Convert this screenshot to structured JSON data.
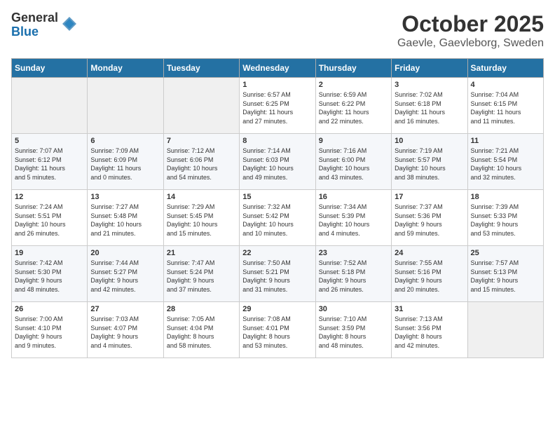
{
  "logo": {
    "general": "General",
    "blue": "Blue"
  },
  "title": "October 2025",
  "subtitle": "Gaevle, Gaevleborg, Sweden",
  "days_of_week": [
    "Sunday",
    "Monday",
    "Tuesday",
    "Wednesday",
    "Thursday",
    "Friday",
    "Saturday"
  ],
  "weeks": [
    [
      {
        "day": "",
        "info": ""
      },
      {
        "day": "",
        "info": ""
      },
      {
        "day": "",
        "info": ""
      },
      {
        "day": "1",
        "info": "Sunrise: 6:57 AM\nSunset: 6:25 PM\nDaylight: 11 hours\nand 27 minutes."
      },
      {
        "day": "2",
        "info": "Sunrise: 6:59 AM\nSunset: 6:22 PM\nDaylight: 11 hours\nand 22 minutes."
      },
      {
        "day": "3",
        "info": "Sunrise: 7:02 AM\nSunset: 6:18 PM\nDaylight: 11 hours\nand 16 minutes."
      },
      {
        "day": "4",
        "info": "Sunrise: 7:04 AM\nSunset: 6:15 PM\nDaylight: 11 hours\nand 11 minutes."
      }
    ],
    [
      {
        "day": "5",
        "info": "Sunrise: 7:07 AM\nSunset: 6:12 PM\nDaylight: 11 hours\nand 5 minutes."
      },
      {
        "day": "6",
        "info": "Sunrise: 7:09 AM\nSunset: 6:09 PM\nDaylight: 11 hours\nand 0 minutes."
      },
      {
        "day": "7",
        "info": "Sunrise: 7:12 AM\nSunset: 6:06 PM\nDaylight: 10 hours\nand 54 minutes."
      },
      {
        "day": "8",
        "info": "Sunrise: 7:14 AM\nSunset: 6:03 PM\nDaylight: 10 hours\nand 49 minutes."
      },
      {
        "day": "9",
        "info": "Sunrise: 7:16 AM\nSunset: 6:00 PM\nDaylight: 10 hours\nand 43 minutes."
      },
      {
        "day": "10",
        "info": "Sunrise: 7:19 AM\nSunset: 5:57 PM\nDaylight: 10 hours\nand 38 minutes."
      },
      {
        "day": "11",
        "info": "Sunrise: 7:21 AM\nSunset: 5:54 PM\nDaylight: 10 hours\nand 32 minutes."
      }
    ],
    [
      {
        "day": "12",
        "info": "Sunrise: 7:24 AM\nSunset: 5:51 PM\nDaylight: 10 hours\nand 26 minutes."
      },
      {
        "day": "13",
        "info": "Sunrise: 7:27 AM\nSunset: 5:48 PM\nDaylight: 10 hours\nand 21 minutes."
      },
      {
        "day": "14",
        "info": "Sunrise: 7:29 AM\nSunset: 5:45 PM\nDaylight: 10 hours\nand 15 minutes."
      },
      {
        "day": "15",
        "info": "Sunrise: 7:32 AM\nSunset: 5:42 PM\nDaylight: 10 hours\nand 10 minutes."
      },
      {
        "day": "16",
        "info": "Sunrise: 7:34 AM\nSunset: 5:39 PM\nDaylight: 10 hours\nand 4 minutes."
      },
      {
        "day": "17",
        "info": "Sunrise: 7:37 AM\nSunset: 5:36 PM\nDaylight: 9 hours\nand 59 minutes."
      },
      {
        "day": "18",
        "info": "Sunrise: 7:39 AM\nSunset: 5:33 PM\nDaylight: 9 hours\nand 53 minutes."
      }
    ],
    [
      {
        "day": "19",
        "info": "Sunrise: 7:42 AM\nSunset: 5:30 PM\nDaylight: 9 hours\nand 48 minutes."
      },
      {
        "day": "20",
        "info": "Sunrise: 7:44 AM\nSunset: 5:27 PM\nDaylight: 9 hours\nand 42 minutes."
      },
      {
        "day": "21",
        "info": "Sunrise: 7:47 AM\nSunset: 5:24 PM\nDaylight: 9 hours\nand 37 minutes."
      },
      {
        "day": "22",
        "info": "Sunrise: 7:50 AM\nSunset: 5:21 PM\nDaylight: 9 hours\nand 31 minutes."
      },
      {
        "day": "23",
        "info": "Sunrise: 7:52 AM\nSunset: 5:18 PM\nDaylight: 9 hours\nand 26 minutes."
      },
      {
        "day": "24",
        "info": "Sunrise: 7:55 AM\nSunset: 5:16 PM\nDaylight: 9 hours\nand 20 minutes."
      },
      {
        "day": "25",
        "info": "Sunrise: 7:57 AM\nSunset: 5:13 PM\nDaylight: 9 hours\nand 15 minutes."
      }
    ],
    [
      {
        "day": "26",
        "info": "Sunrise: 7:00 AM\nSunset: 4:10 PM\nDaylight: 9 hours\nand 9 minutes."
      },
      {
        "day": "27",
        "info": "Sunrise: 7:03 AM\nSunset: 4:07 PM\nDaylight: 9 hours\nand 4 minutes."
      },
      {
        "day": "28",
        "info": "Sunrise: 7:05 AM\nSunset: 4:04 PM\nDaylight: 8 hours\nand 58 minutes."
      },
      {
        "day": "29",
        "info": "Sunrise: 7:08 AM\nSunset: 4:01 PM\nDaylight: 8 hours\nand 53 minutes."
      },
      {
        "day": "30",
        "info": "Sunrise: 7:10 AM\nSunset: 3:59 PM\nDaylight: 8 hours\nand 48 minutes."
      },
      {
        "day": "31",
        "info": "Sunrise: 7:13 AM\nSunset: 3:56 PM\nDaylight: 8 hours\nand 42 minutes."
      },
      {
        "day": "",
        "info": ""
      }
    ]
  ]
}
